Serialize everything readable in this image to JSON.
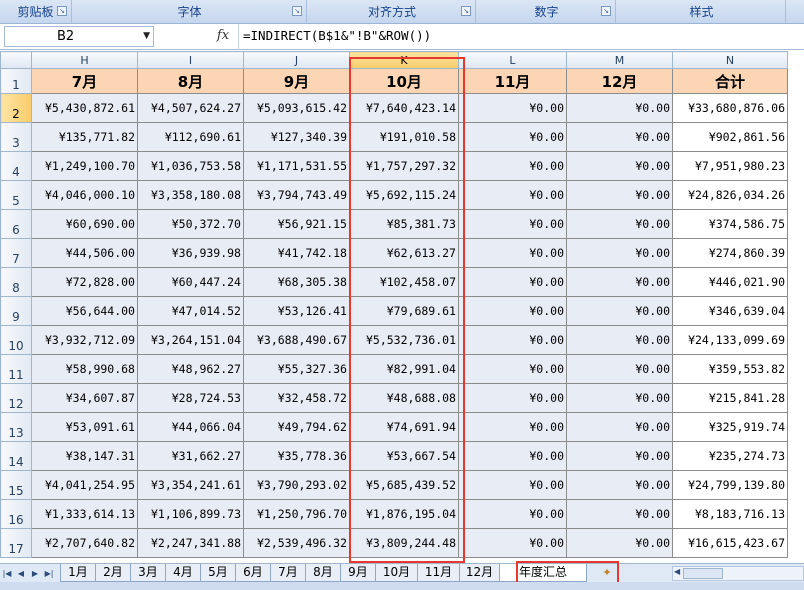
{
  "ribbon": {
    "groups": [
      "剪贴板",
      "字体",
      "对齐方式",
      "数字",
      "样式"
    ]
  },
  "formula_bar": {
    "name_box": "B2",
    "fx_label": "fx",
    "formula": "=INDIRECT(B$1&\"!B\"&ROW())"
  },
  "columns": [
    "H",
    "I",
    "J",
    "K",
    "L",
    "M",
    "N"
  ],
  "selected_column": "K",
  "header_row": [
    "7月",
    "8月",
    "9月",
    "10月",
    "11月",
    "12月",
    "合计"
  ],
  "row_numbers": [
    "1",
    "2",
    "3",
    "4",
    "5",
    "6",
    "7",
    "8",
    "9",
    "10",
    "11",
    "12",
    "13",
    "14",
    "15",
    "16",
    "17"
  ],
  "rows": [
    [
      "¥5,430,872.61",
      "¥4,507,624.27",
      "¥5,093,615.42",
      "¥7,640,423.14",
      "¥0.00",
      "¥0.00",
      "¥33,680,876.06"
    ],
    [
      "¥135,771.82",
      "¥112,690.61",
      "¥127,340.39",
      "¥191,010.58",
      "¥0.00",
      "¥0.00",
      "¥902,861.56"
    ],
    [
      "¥1,249,100.70",
      "¥1,036,753.58",
      "¥1,171,531.55",
      "¥1,757,297.32",
      "¥0.00",
      "¥0.00",
      "¥7,951,980.23"
    ],
    [
      "¥4,046,000.10",
      "¥3,358,180.08",
      "¥3,794,743.49",
      "¥5,692,115.24",
      "¥0.00",
      "¥0.00",
      "¥24,826,034.26"
    ],
    [
      "¥60,690.00",
      "¥50,372.70",
      "¥56,921.15",
      "¥85,381.73",
      "¥0.00",
      "¥0.00",
      "¥374,586.75"
    ],
    [
      "¥44,506.00",
      "¥36,939.98",
      "¥41,742.18",
      "¥62,613.27",
      "¥0.00",
      "¥0.00",
      "¥274,860.39"
    ],
    [
      "¥72,828.00",
      "¥60,447.24",
      "¥68,305.38",
      "¥102,458.07",
      "¥0.00",
      "¥0.00",
      "¥446,021.90"
    ],
    [
      "¥56,644.00",
      "¥47,014.52",
      "¥53,126.41",
      "¥79,689.61",
      "¥0.00",
      "¥0.00",
      "¥346,639.04"
    ],
    [
      "¥3,932,712.09",
      "¥3,264,151.04",
      "¥3,688,490.67",
      "¥5,532,736.01",
      "¥0.00",
      "¥0.00",
      "¥24,133,099.69"
    ],
    [
      "¥58,990.68",
      "¥48,962.27",
      "¥55,327.36",
      "¥82,991.04",
      "¥0.00",
      "¥0.00",
      "¥359,553.82"
    ],
    [
      "¥34,607.87",
      "¥28,724.53",
      "¥32,458.72",
      "¥48,688.08",
      "¥0.00",
      "¥0.00",
      "¥215,841.28"
    ],
    [
      "¥53,091.61",
      "¥44,066.04",
      "¥49,794.62",
      "¥74,691.94",
      "¥0.00",
      "¥0.00",
      "¥325,919.74"
    ],
    [
      "¥38,147.31",
      "¥31,662.27",
      "¥35,778.36",
      "¥53,667.54",
      "¥0.00",
      "¥0.00",
      "¥235,274.73"
    ],
    [
      "¥4,041,254.95",
      "¥3,354,241.61",
      "¥3,790,293.02",
      "¥5,685,439.52",
      "¥0.00",
      "¥0.00",
      "¥24,799,139.80"
    ],
    [
      "¥1,333,614.13",
      "¥1,106,899.73",
      "¥1,250,796.70",
      "¥1,876,195.04",
      "¥0.00",
      "¥0.00",
      "¥8,183,716.13"
    ],
    [
      "¥2,707,640.82",
      "¥2,247,341.88",
      "¥2,539,496.32",
      "¥3,809,244.48",
      "¥0.00",
      "¥0.00",
      "¥16,615,423.67"
    ]
  ],
  "sheet_tabs": [
    "1月",
    "2月",
    "3月",
    "4月",
    "5月",
    "6月",
    "7月",
    "8月",
    "9月",
    "10月",
    "11月",
    "12月",
    "年度汇总"
  ],
  "active_tab": "年度汇总",
  "highlight_color": "#e8372c",
  "header_fill_color": "#fcd5b4",
  "data_fill_color": "#e8ecf5"
}
